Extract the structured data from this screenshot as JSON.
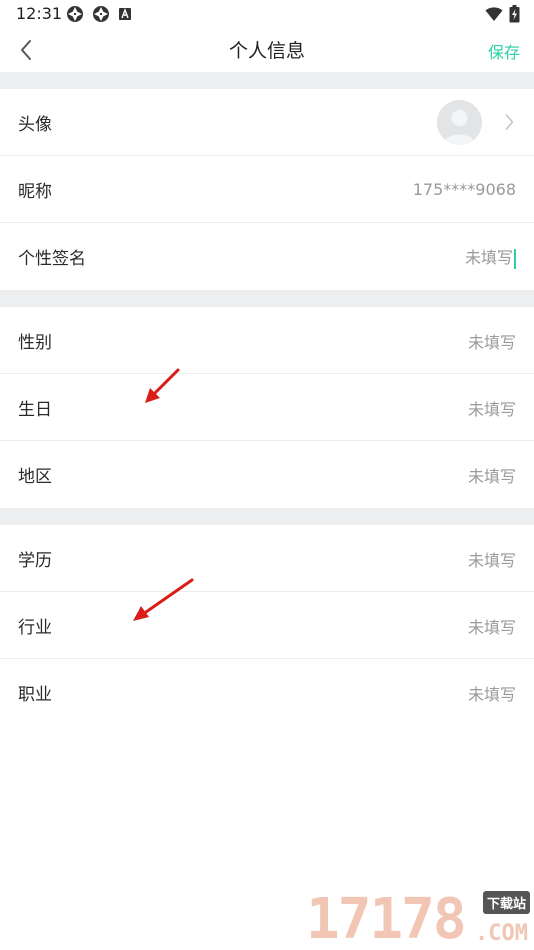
{
  "status_bar": {
    "time": "12:31",
    "left_icons": [
      "aperture-icon",
      "aperture-icon",
      "notification-a-icon"
    ],
    "right_icons": [
      "wifi-icon",
      "battery-charging-icon"
    ]
  },
  "nav": {
    "back_icon": "chevron-left-icon",
    "title": "个人信息",
    "save_label": "保存",
    "accent_color": "#2ecfa6"
  },
  "sections": {
    "profile": {
      "avatar": {
        "label": "头像"
      },
      "nickname": {
        "label": "昵称",
        "value": "175****9068"
      },
      "signature": {
        "label": "个性签名",
        "value": "未填写"
      }
    },
    "basic": {
      "gender": {
        "label": "性别",
        "value": "未填写"
      },
      "birthday": {
        "label": "生日",
        "value": "未填写"
      },
      "region": {
        "label": "地区",
        "value": "未填写"
      }
    },
    "career": {
      "education": {
        "label": "学历",
        "value": "未填写"
      },
      "industry": {
        "label": "行业",
        "value": "未填写"
      },
      "occupation": {
        "label": "职业",
        "value": "未填写"
      }
    }
  },
  "watermark": {
    "digits": "17178",
    "tag": "下载站",
    "domain": ".COM",
    "color": "#f2c6b4"
  }
}
